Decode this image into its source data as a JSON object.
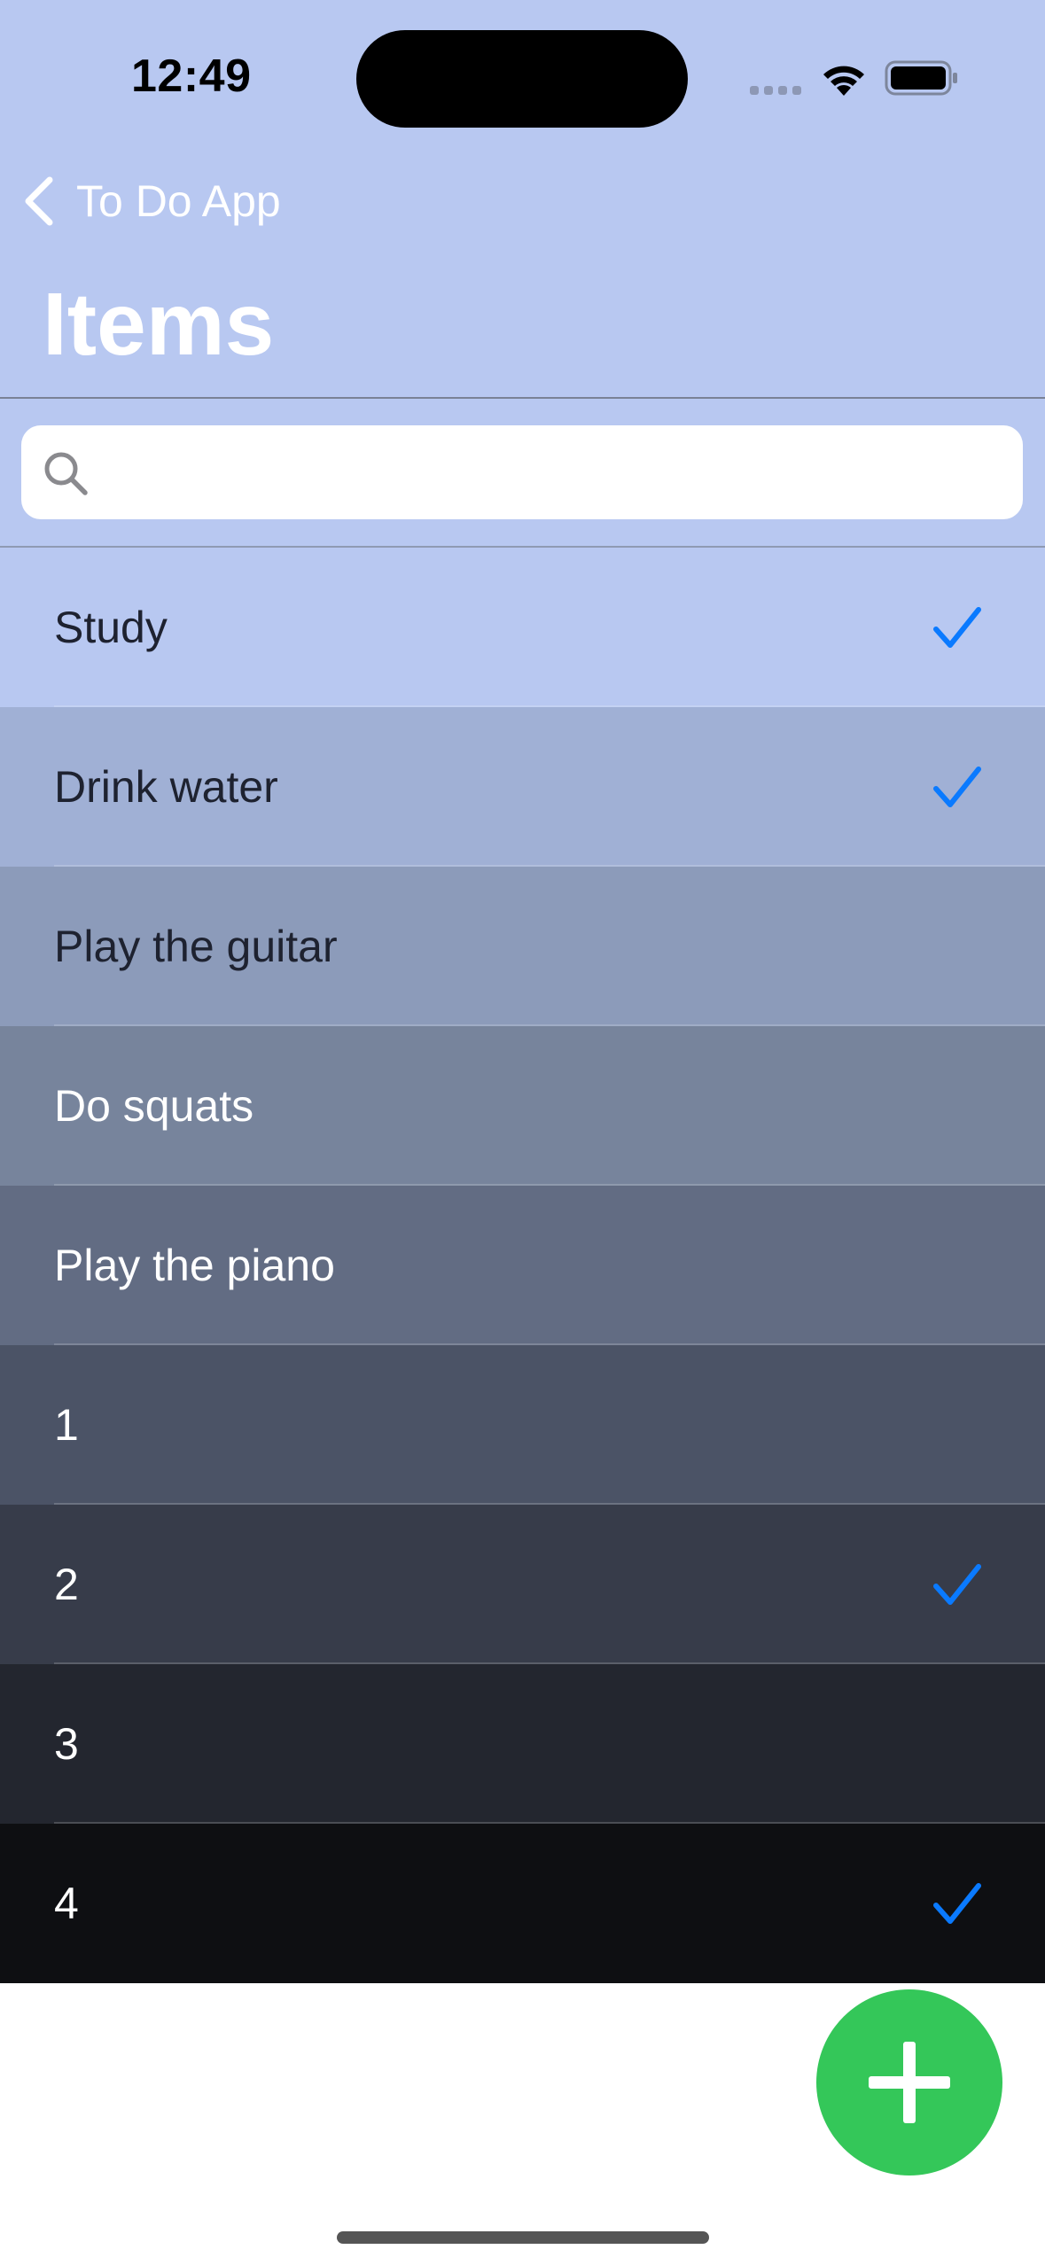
{
  "status_bar": {
    "time": "12:49"
  },
  "nav": {
    "back_label": "To Do App",
    "title": "Items"
  },
  "search": {
    "placeholder": "",
    "value": ""
  },
  "colors": {
    "header_bg": "#b8c8f1",
    "accent": "#0a7aff",
    "fab": "#34c759"
  },
  "items": [
    {
      "label": "Study",
      "done": true,
      "bg": "#b8c8f1",
      "fg": "#1e2230"
    },
    {
      "label": "Drink water",
      "done": true,
      "bg": "#a0b0d5",
      "fg": "#1e2230"
    },
    {
      "label": "Play the guitar",
      "done": false,
      "bg": "#8c9bba",
      "fg": "#1e2230"
    },
    {
      "label": "Do squats",
      "done": false,
      "bg": "#77849c",
      "fg": "#ffffff"
    },
    {
      "label": "Play the piano",
      "done": false,
      "bg": "#626c83",
      "fg": "#ffffff"
    },
    {
      "label": "1",
      "done": false,
      "bg": "#4b5366",
      "fg": "#ffffff"
    },
    {
      "label": "2",
      "done": true,
      "bg": "#373c4a",
      "fg": "#ffffff"
    },
    {
      "label": "3",
      "done": false,
      "bg": "#23262f",
      "fg": "#ffffff"
    },
    {
      "label": "4",
      "done": true,
      "bg": "#0e0f12",
      "fg": "#ffffff"
    }
  ],
  "icons": {
    "back": "chevron-left-icon",
    "search": "search-icon",
    "check": "checkmark-icon",
    "add": "plus-icon"
  }
}
